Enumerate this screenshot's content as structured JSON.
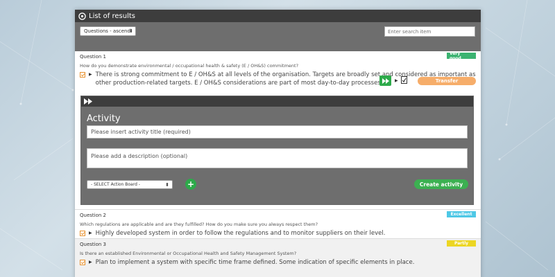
{
  "window": {
    "title": "List of results"
  },
  "filters": {
    "sort_value": "Questions - ascendi",
    "search_placeholder": "Enter search item"
  },
  "questions": [
    {
      "label": "Question 1",
      "text": "How do you demonstrate environmental / occupational health & safety (E / OH&S) commitment?",
      "answer": "There is strong commitment to E / OH&S at all levels of the organisation. Targets are broadly set and considered as important as other production-related targets. E / OH&S considerations are part of most day-to-day processes.",
      "rating": "Very good",
      "rating_color": "#3cb371"
    },
    {
      "label": "Question 2",
      "text": "Which regulations are applicable and are they fulfilled? How do you make sure you always respect them?",
      "answer": "Highly developed system in order to follow the regulations and to monitor suppliers on their level.",
      "rating": "Excellent",
      "rating_color": "#4ec8e6"
    },
    {
      "label": "Question 3",
      "text": "Is there an established Environmental or Occupational Health and Safety Management System?",
      "answer": "Plan to implement a system with specific time frame defined. Some indication of specific elements in place.",
      "rating": "Partly",
      "rating_color": "#ecd623"
    }
  ],
  "actions": {
    "transfer_label": "Transfer"
  },
  "activity": {
    "title": "Activity",
    "title_placeholder": "Please insert activity title (required)",
    "description_placeholder": "Please add a description (optional)",
    "board_select": "- SELECT Action Board -",
    "plus_label": "+",
    "create_label": "Create activity"
  },
  "colors": {
    "accent_orange": "#f6ad6a",
    "accent_green": "#3cb051",
    "dark_bar": "#3d3d3d",
    "gray_bar": "#6e6e6e"
  }
}
